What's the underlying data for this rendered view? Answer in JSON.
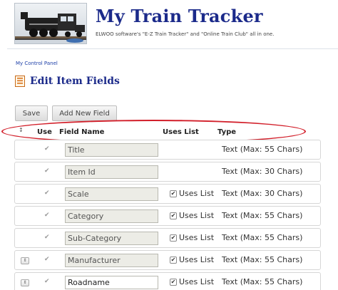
{
  "header": {
    "title": "My Train Tracker",
    "tagline": "ELWOO software's \"E-Z Train Tracker\" and \"Online Train Club\" all in one.",
    "logo_icon": "locomotive-icon"
  },
  "breadcrumb": "My Control Panel",
  "page": {
    "heading": "Edit Item Fields",
    "heading_icon": "list-icon"
  },
  "buttons": {
    "save": "Save",
    "add_new_field": "Add New Field"
  },
  "table": {
    "sort_icon": "sort-handle-icon",
    "columns": {
      "sort": "↕",
      "use": "Use",
      "field_name": "Field Name",
      "uses_list": "Uses List",
      "type": "Type"
    },
    "rows": [
      {
        "name": "Title",
        "uses_list_label": "",
        "type": "Text (Max: 55 Chars)"
      },
      {
        "name": "Item Id",
        "uses_list_label": "",
        "type": "Text (Max: 30 Chars)"
      },
      {
        "name": "Scale",
        "uses_list_label": "Uses List",
        "type": "Text (Max: 30 Chars)"
      },
      {
        "name": "Category",
        "uses_list_label": "Uses List",
        "type": "Text (Max: 55 Chars)"
      },
      {
        "name": "Sub-Category",
        "uses_list_label": "Uses List",
        "type": "Text (Max: 55 Chars)"
      },
      {
        "name": "Manufacturer",
        "uses_list_label": "Uses List",
        "type": "Text (Max: 55 Chars)"
      },
      {
        "name": "Roadname",
        "uses_list_label": "Uses List",
        "type": "Text (Max: 55 Chars)"
      }
    ]
  },
  "colors": {
    "title": "#1b2a8a",
    "highlight_ellipse": "#d21f2a",
    "link": "#1d3fa8"
  }
}
